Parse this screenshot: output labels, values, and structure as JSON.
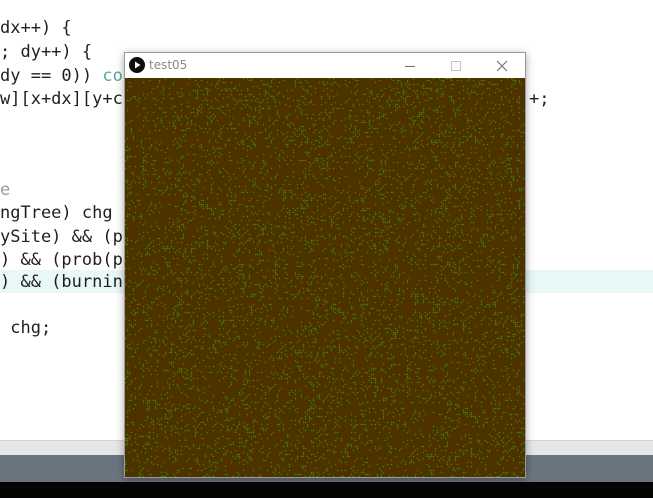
{
  "editor": {
    "lines": [
      {
        "text": "dx++) {"
      },
      {
        "text": "; dy++) {"
      },
      {
        "pre": "dy == 0)) ",
        "kw": "co"
      },
      {
        "pre": "w][x+dx][y+c",
        "post": "+;"
      },
      {
        "text": "e"
      },
      {
        "text": "ngTree) chg"
      },
      {
        "text": "ySite) && (p"
      },
      {
        "text": ") && (prob(p"
      },
      {
        "text": ") && (burnin"
      },
      {
        "text": " chg;"
      }
    ]
  },
  "sketch_window": {
    "title": "test05",
    "canvas": {
      "background_color": "#4d3200",
      "tree_color": "#39c800",
      "tree_density": 0.16
    }
  },
  "colors": {
    "console_bar": "#6a7580",
    "taskbar": "#050505",
    "highlight_row": "#e8f7f8",
    "keyword": "#5aa99a"
  }
}
